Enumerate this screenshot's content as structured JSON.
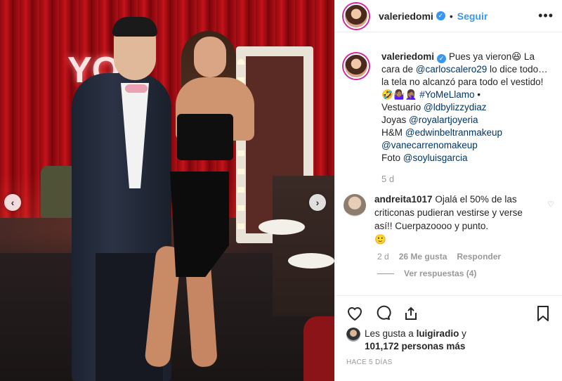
{
  "post": {
    "username": "valeriedomi",
    "follow_label": "Seguir",
    "more_label": "•••",
    "caption": {
      "username": "valeriedomi",
      "line1_text": "Pues ya vieron😆 La cara de ",
      "mention1": "@carloscalero29",
      "line2_text": " lo dice todo… la tela no alcanzó para todo el vestido! ",
      "emojis": "🤣🤷🏽‍♀️🤦🏽‍♀️",
      "hashtag": "#YoMeLlamo",
      "bullet": " •",
      "vestuario_label": "Vestuario ",
      "vestuario_mention": "@ldbylizzydiaz",
      "joyas_label": "Joyas ",
      "joyas_mention": "@royalartjoyeria",
      "hm_label": "H&M ",
      "hm_mention": "@edwinbeltranmakeup",
      "extra_mention": "@vanecarrenomakeup",
      "foto_label": "Foto ",
      "foto_mention": "@soyluisgarcia",
      "time": "5 d"
    },
    "comment": {
      "username": "andreita1017",
      "text": "Ojalá el 50% de las criticonas pudieran vestirse y verse así!! Cuerpazoooo y punto.",
      "emoji": "🙂",
      "time": "2 d",
      "likes": "26 Me gusta",
      "reply_label": "Responder",
      "view_replies": "Ver respuestas (4)"
    },
    "likes": {
      "prefix": "Les gusta a ",
      "user": "luigiradio",
      "and": " y",
      "count": "101,172 personas más"
    },
    "timestamp": "HACE 5 DÍAS"
  },
  "photo": {
    "sign_text": "YO"
  },
  "colors": {
    "accent_blue": "#3897f0",
    "link": "#003569",
    "muted": "#999999"
  },
  "icons": [
    "verified-icon",
    "more-icon",
    "heart-icon",
    "comment-icon",
    "share-icon",
    "save-icon",
    "chevron-left-icon",
    "chevron-right-icon"
  ]
}
